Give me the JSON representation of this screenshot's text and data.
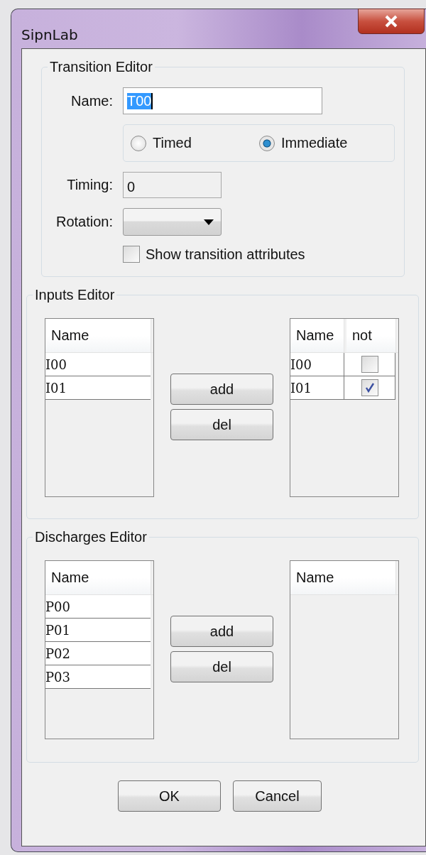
{
  "window": {
    "title": "SipnLab"
  },
  "transition_editor": {
    "title": "Transition Editor",
    "name_label": "Name:",
    "name_value": "T00",
    "name_highlighted": true,
    "mode_options": [
      {
        "label": "Timed",
        "selected": false
      },
      {
        "label": "Immediate",
        "selected": true
      }
    ],
    "timing_label": "Timing:",
    "timing_value": "0",
    "rotation_label": "Rotation:",
    "show_attributes": {
      "label": "Show transition attributes",
      "checked": false
    }
  },
  "inputs_editor": {
    "title": "Inputs Editor",
    "left_table": {
      "columns": [
        "Name"
      ],
      "rows": [
        {
          "name": "I00"
        },
        {
          "name": "I01"
        }
      ]
    },
    "buttons": [
      "add",
      "del"
    ],
    "right_table": {
      "columns": [
        "Name",
        "not"
      ],
      "rows": [
        {
          "name": "I00",
          "not": false
        },
        {
          "name": "I01",
          "not": true
        }
      ]
    }
  },
  "discharges_editor": {
    "title": "Discharges Editor",
    "left_table": {
      "columns": [
        "Name"
      ],
      "rows": [
        {
          "name": "P00"
        },
        {
          "name": "P01"
        },
        {
          "name": "P02"
        },
        {
          "name": "P03"
        }
      ]
    },
    "buttons": [
      "add",
      "del"
    ],
    "right_table": {
      "columns": [
        "Name"
      ]
    }
  },
  "buttons": [
    "OK",
    "Cancel"
  ]
}
